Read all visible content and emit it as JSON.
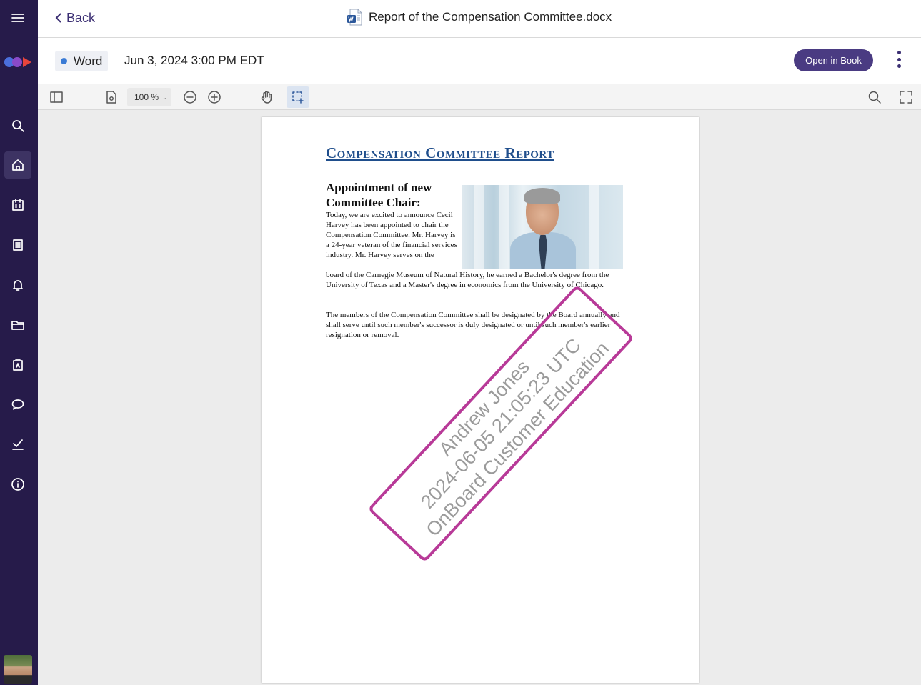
{
  "app": {
    "back_label": "Back",
    "document_title": "Report of the Compensation Committee.docx"
  },
  "info": {
    "type_chip": "Word",
    "type_chip_color": "#3a7bd5",
    "date": "Jun 3, 2024 3:00 PM EDT",
    "open_button": "Open in Book"
  },
  "viewer": {
    "zoom_value": "100 %"
  },
  "sidebar": {
    "items": [
      "menu-icon",
      "search-icon",
      "home-icon",
      "calendar-icon",
      "book-icon",
      "bell-icon",
      "folder-icon",
      "directory-icon",
      "chat-icon",
      "approvals-icon",
      "info-icon"
    ],
    "active": "home-icon",
    "background": "#261b4a"
  },
  "document": {
    "title": "Compensation Committee Report",
    "heading": "Appointment of new Committee Chair:",
    "para1_narrow": "Today, we are excited to announce Cecil Harvey has been appointed to chair the Compensation Committee. Mr. Harvey is a 24-year veteran of the financial services industry. Mr. Harvey serves on the",
    "para1_wide": "board of the Carnegie Museum of Natural History, he earned a Bachelor's degree from the University of Texas and a Master's degree in economics from the University of Chicago.",
    "para2": "The members of the Compensation Committee shall be designated by the Board annually and shall serve until such member's successor is duly designated or until such member's earlier resignation or removal."
  },
  "watermark": {
    "line1": "Andrew Jones",
    "line2": "2024-06-05 21:05:23 UTC",
    "line3": "OnBoard Customer Education",
    "border_color": "#b83a98"
  }
}
